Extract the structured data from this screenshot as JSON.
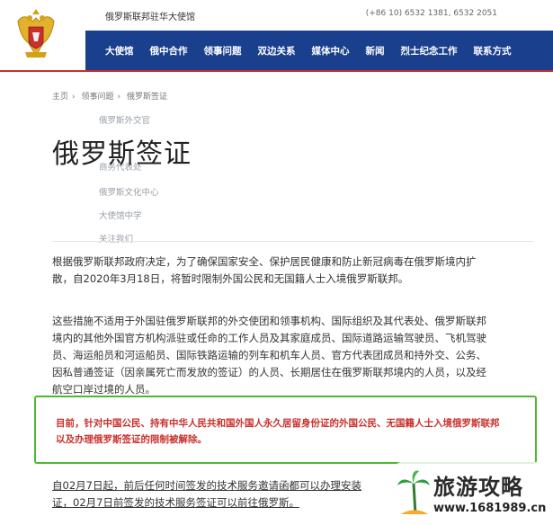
{
  "header": {
    "embassy_name": "俄罗斯联邦驻华大使馆",
    "phone": "(+86 10) 6532 1381, 6532 2051"
  },
  "nav": {
    "items": [
      "大使馆",
      "俄中合作",
      "领事问题",
      "双边关系",
      "媒体中心",
      "新闻",
      "烈士纪念工作",
      "联系方式"
    ]
  },
  "breadcrumb": {
    "home": "主页",
    "section": "领事问题",
    "current": "俄罗斯签证"
  },
  "dropdown": {
    "items": [
      "俄罗斯外交官",
      "商务代表处",
      "俄罗斯文化中心",
      "大使馆中学",
      "关注我们"
    ]
  },
  "page": {
    "title": "俄罗斯签证",
    "para1_line1": "根据俄罗斯联邦政府决定，为了确保国家安全、保护居民健康和防止新冠病毒在俄罗斯境内扩",
    "para1_line2": "散，自2020年3月18日，将暂时限制外国公民和无国籍人士入境俄罗斯联邦。",
    "para2_line1": "这些措施不适用于外国驻俄罗斯联邦的外交使团和领事机构、国际组织及其代表处、俄罗斯联邦",
    "para2_line2": "境内的其他外国官方机构派驻或任命的工作人员及其家庭成员、国际道路运输驾驶员、飞机驾驶",
    "para2_line3": "员、海运船员和河运船员、国际铁路运输的列车和机车人员、官方代表团成员和持外交、公务、",
    "para2_line4": "因私普通签证（因亲属死亡而发放的签证）的人员、长期居住在俄罗斯联邦境内的人员，以及经",
    "para2_line5": "航空口岸过境的人员。",
    "notice_line1": "目前，针对中国公民、持有中华人民共和国外国人永久居留身份证的外国公民、无国籍人士入境俄罗斯联邦",
    "notice_line2": "以及办理俄罗斯签证的限制被解除。",
    "para3_line1": "自02月7日起，前后任何时间签发的技术服务邀请函都可以办理安装",
    "para3_line2": "证，02月7日前签发的技术服务签证可以前往俄罗斯。"
  },
  "watermark": {
    "text": "旅游攻略",
    "url": "www.1681989.cn"
  },
  "colors": {
    "nav_bg": "#1a3f8c",
    "accent_red": "#c9302c",
    "notice_border": "#4cba2e"
  }
}
